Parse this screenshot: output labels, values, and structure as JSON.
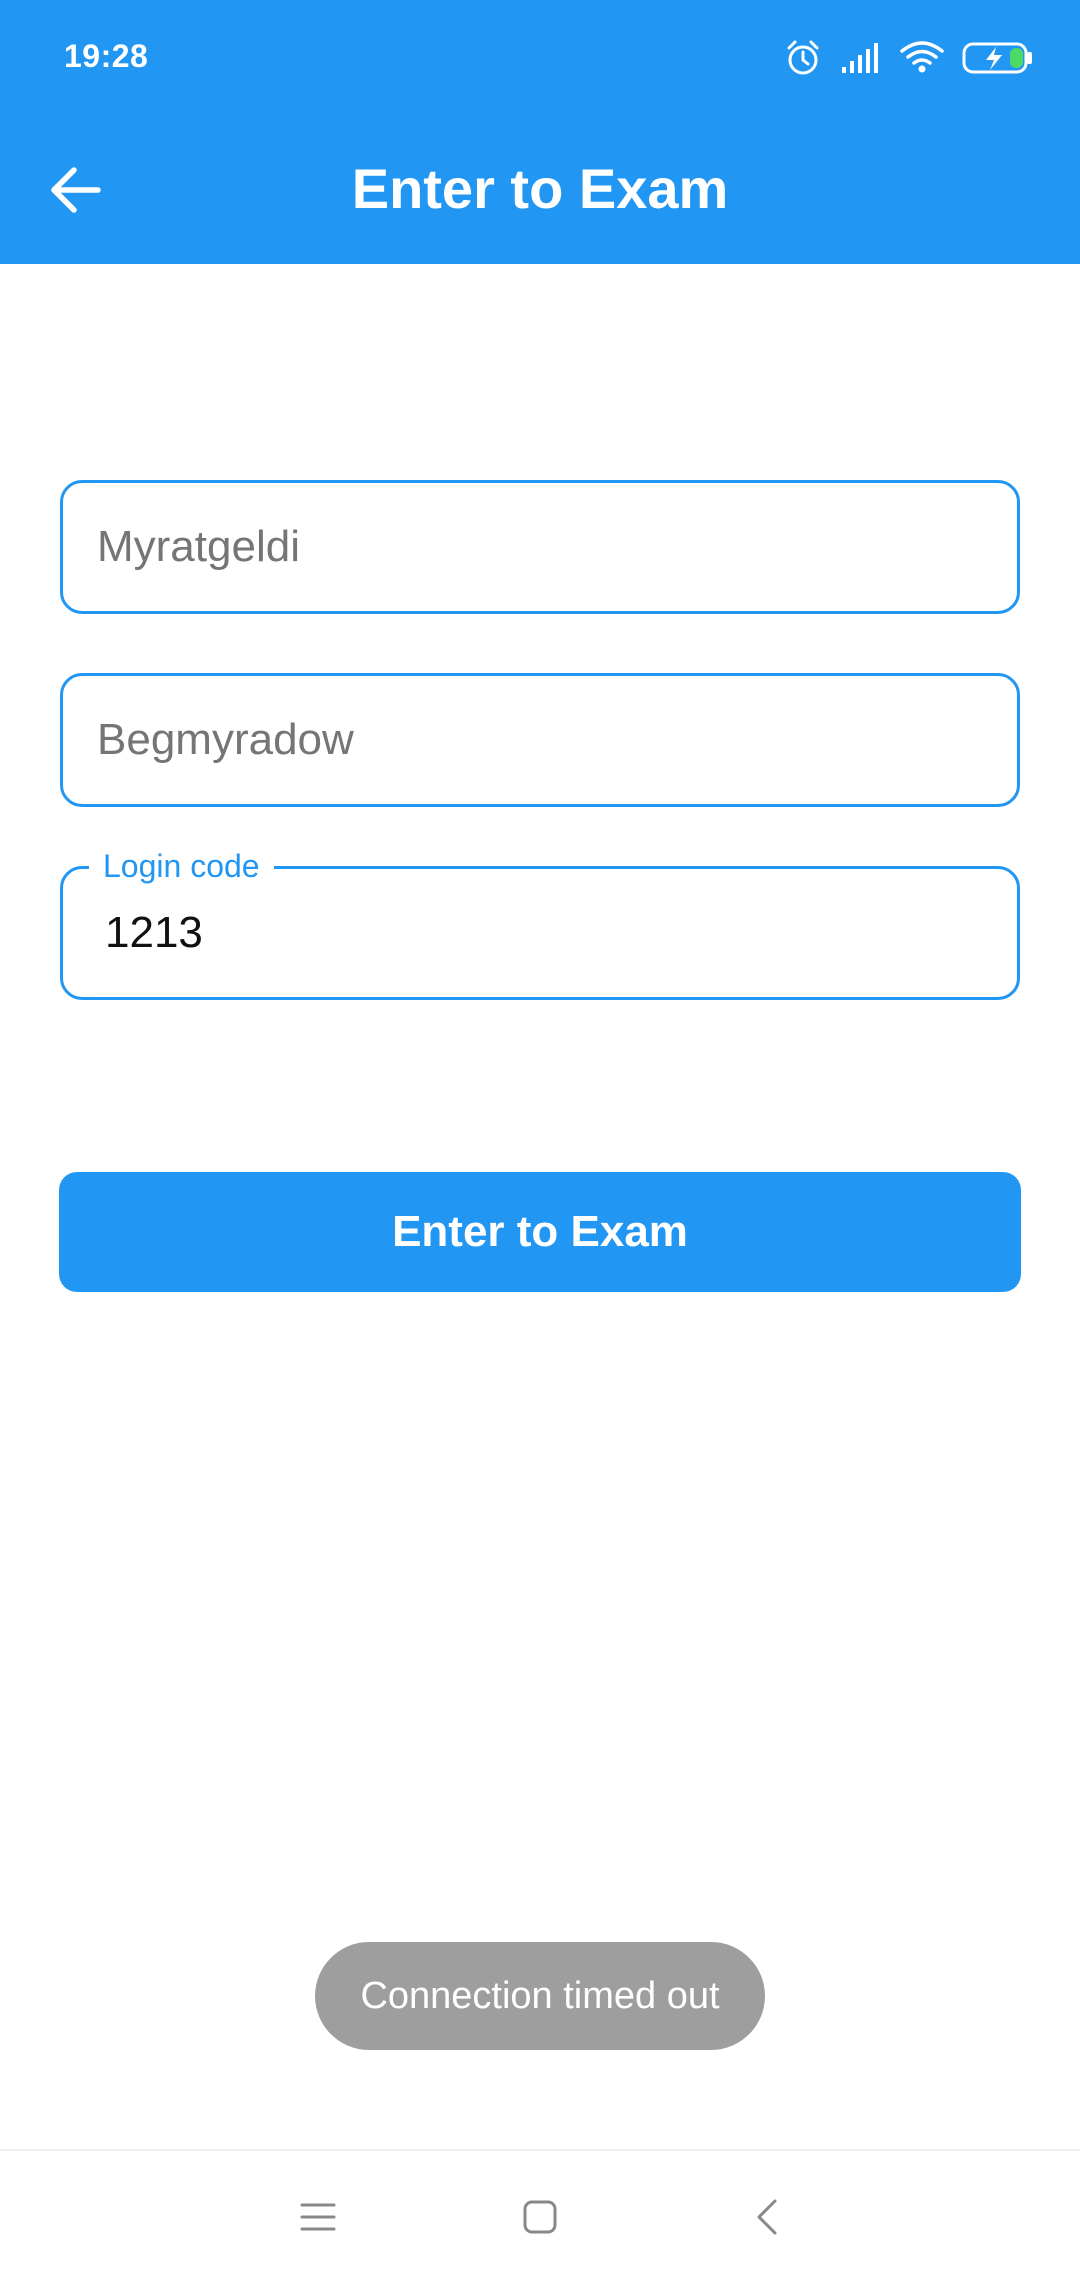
{
  "status_bar": {
    "time": "19:28",
    "icons": [
      "alarm-icon",
      "signal-icon",
      "wifi-icon",
      "battery-charging-icon"
    ]
  },
  "toolbar": {
    "title": "Enter to Exam",
    "back_icon": "arrow-back-icon"
  },
  "form": {
    "first_name": {
      "placeholder": "Myratgeldi",
      "value": ""
    },
    "last_name": {
      "placeholder": "Begmyradow",
      "value": ""
    },
    "login_code": {
      "label": "Login code",
      "value": "1213"
    },
    "submit_label": "Enter to Exam"
  },
  "toast": {
    "message": "Connection timed out"
  },
  "nav_bar": {
    "icons": [
      "menu-icon",
      "home-icon",
      "back-icon"
    ]
  },
  "colors": {
    "primary": "#2196F3",
    "toast_bg": "#9E9E9E",
    "battery_charge": "#4CD964"
  }
}
